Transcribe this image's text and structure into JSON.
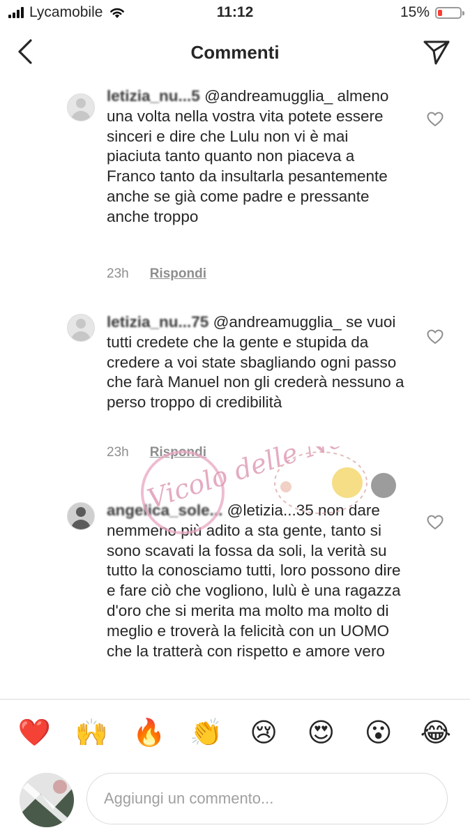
{
  "status_bar": {
    "carrier": "Lycamobile",
    "time": "11:12",
    "battery": "15%",
    "battery_color": "#ff3b30"
  },
  "header": {
    "title": "Commenti",
    "back_icon": "chevron-left-icon",
    "send_icon": "paper-plane-icon"
  },
  "comments": [
    {
      "username": "letizia_nu...5",
      "mention": "@andreamugglia_",
      "text": "almeno una volta nella vostra vita potete essere sinceri e dire che Lulu non vi è mai piaciuta tanto quanto non piaceva a Franco tanto da insultarla pesantemente anche se già come padre e pressante anche troppo",
      "time": "23h",
      "reply": "Rispondi"
    },
    {
      "username": "letizia_nu...75",
      "mention": "@andreamugglia_",
      "text": "se vuoi tutti credete che la gente e stupida da credere a voi state sbagliando ogni passo che farà Manuel non gli crederà nessuno a perso troppo di credibilità",
      "time": "23h",
      "reply": "Rispondi"
    },
    {
      "username": "angelica_sole...",
      "mention": "@letizia...35",
      "text": "non dare nemmeno più adito a sta gente, tanto si sono scavati la fossa da soli, la verità su tutto la conosciamo tutti, loro possono dire e fare ciò che vogliono, lulù è una ragazza d'oro che si merita ma molto ma molto di meglio e troverà la felicità con un UOMO che la tratterà con rispetto e amore vero"
    }
  ],
  "watermark": {
    "text": "Vicolo delle News"
  },
  "reactions": [
    "❤️",
    "🙌",
    "🔥",
    "👏",
    "😢",
    "😍",
    "😮",
    "😂"
  ],
  "input": {
    "placeholder": "Aggiungi un commento..."
  }
}
